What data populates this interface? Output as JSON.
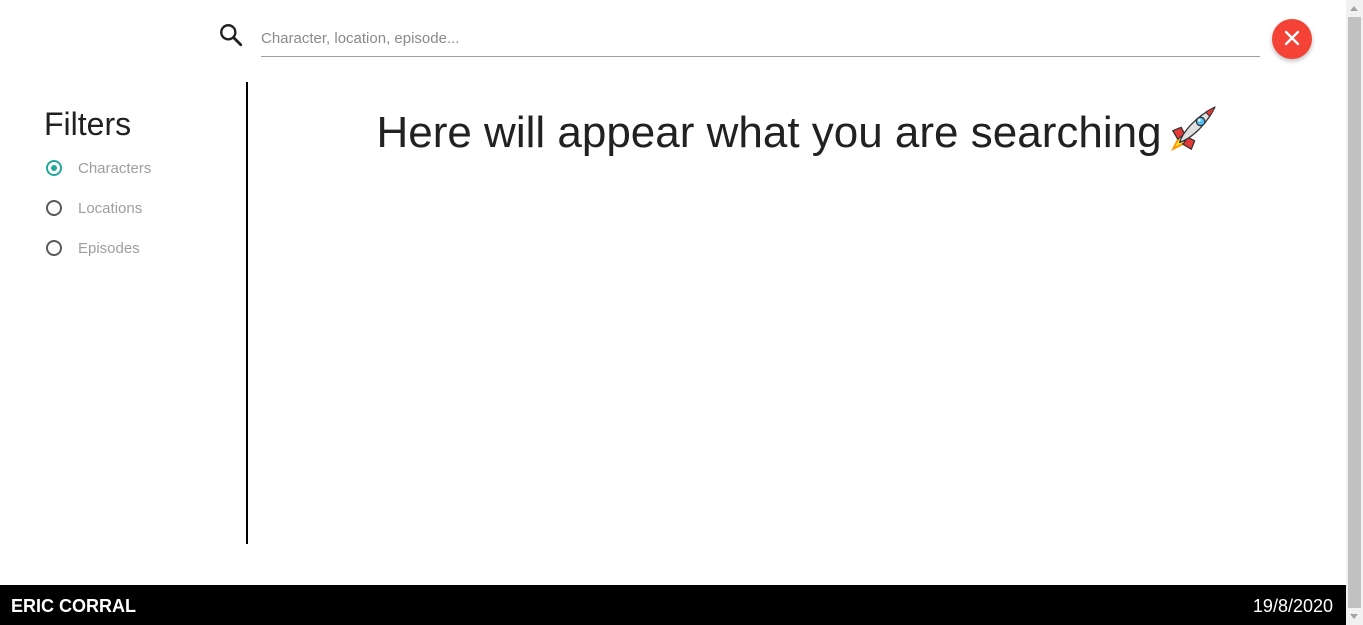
{
  "search": {
    "placeholder": "Character, location, episode...",
    "value": "",
    "icon": "search-icon",
    "clear_icon": "close-icon"
  },
  "sidebar": {
    "title": "Filters",
    "options": [
      {
        "label": "Characters",
        "checked": true
      },
      {
        "label": "Locations",
        "checked": false
      },
      {
        "label": "Episodes",
        "checked": false
      }
    ]
  },
  "main": {
    "message": "Here will appear what you are searching",
    "icon": "rocket-icon"
  },
  "footer": {
    "author": "ERIC CORRAL",
    "date": "19/8/2020"
  },
  "colors": {
    "accent": "#26a69a",
    "clear_button": "#f44336",
    "footer_bg": "#000000"
  }
}
